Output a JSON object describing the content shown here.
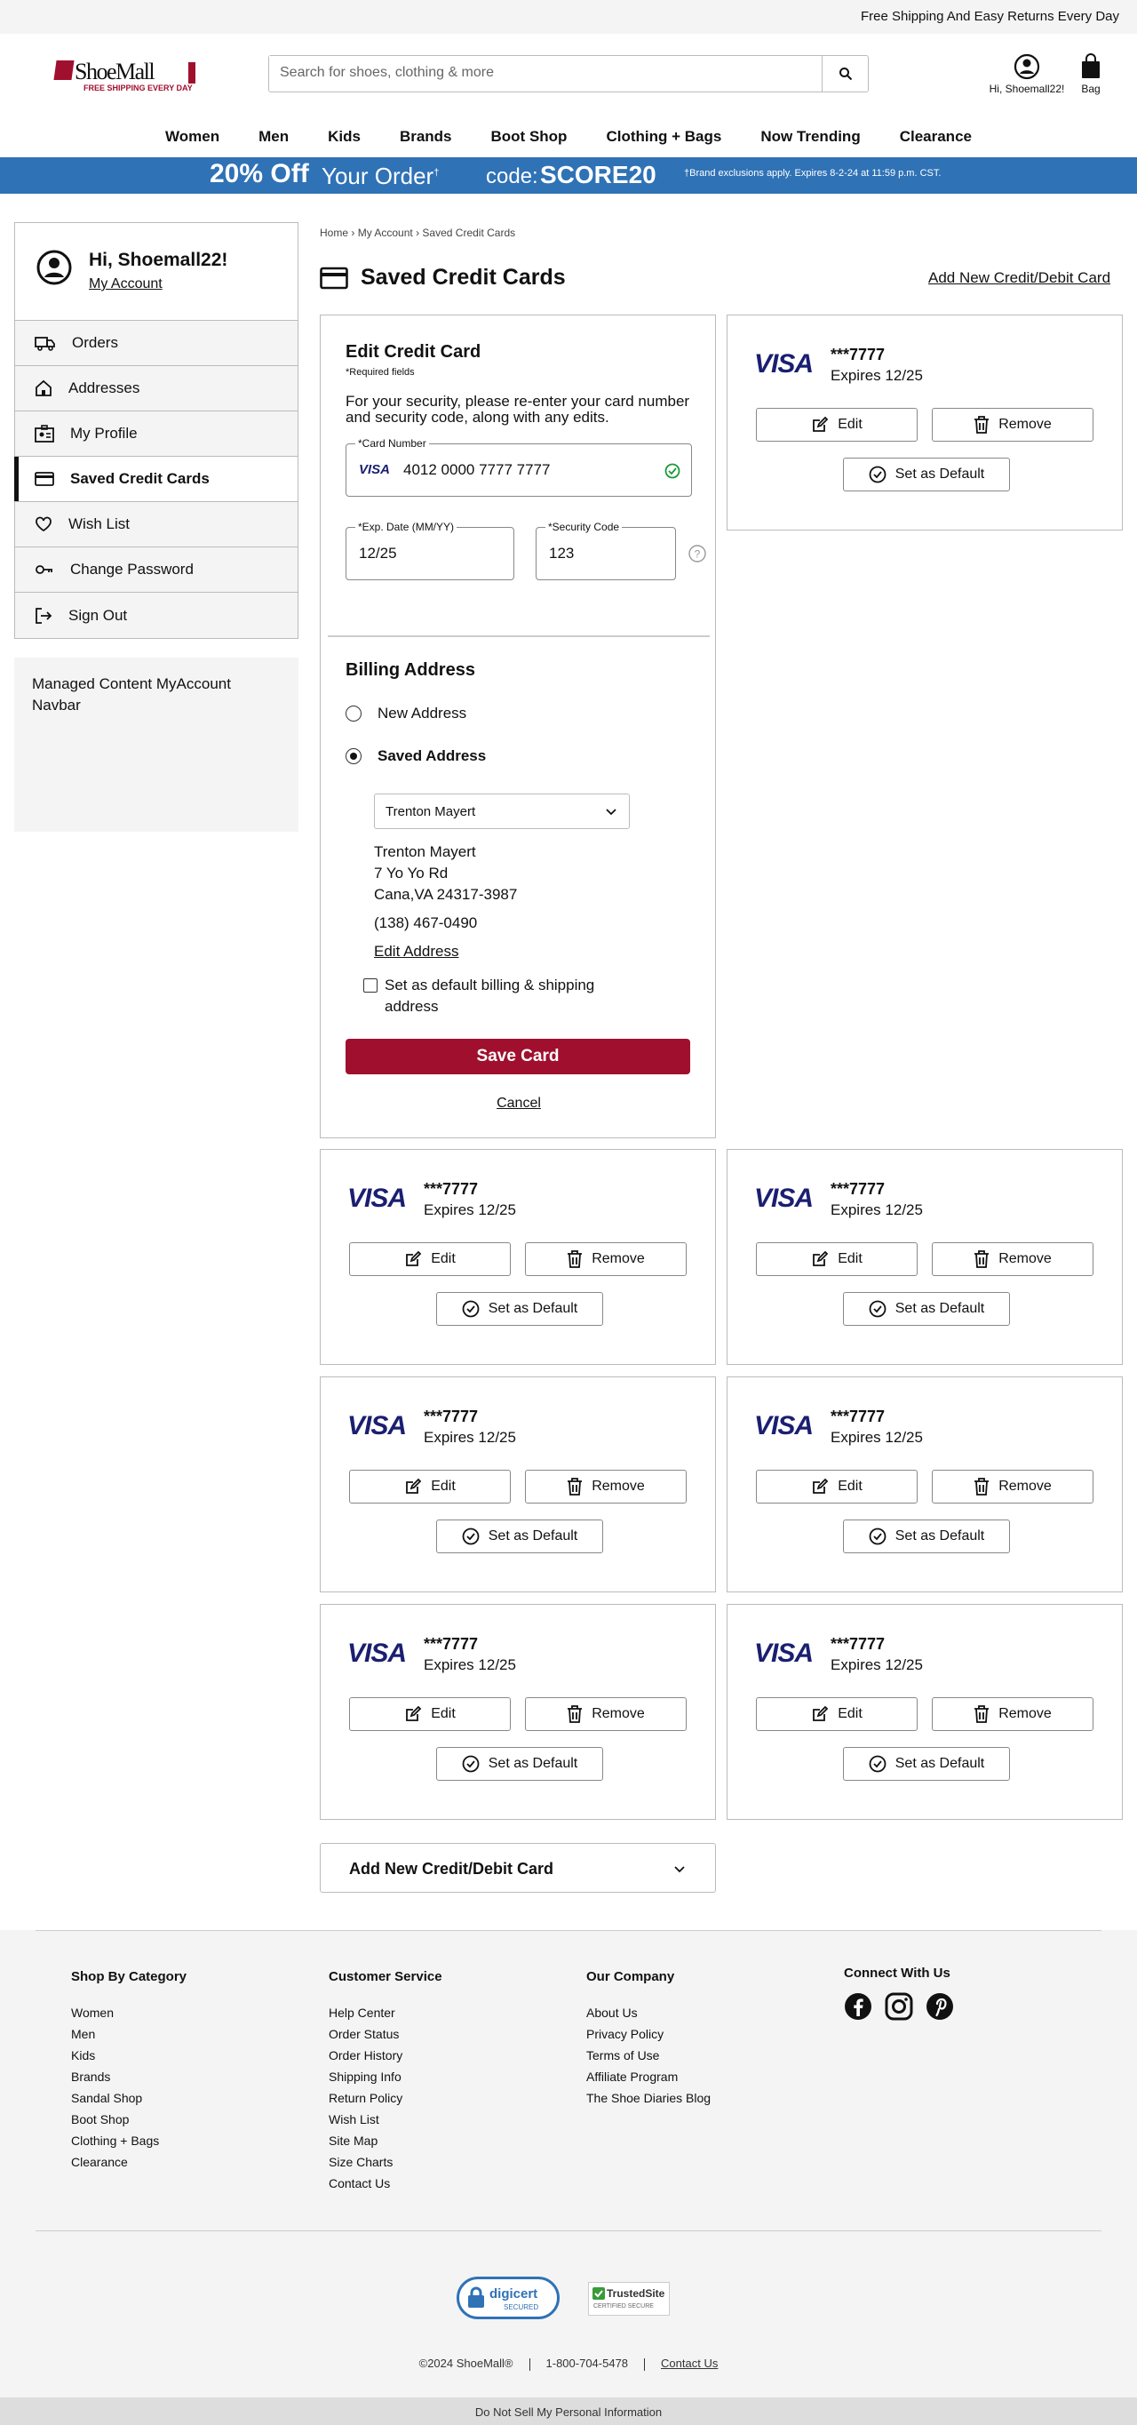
{
  "topbar": {
    "message": "Free Shipping And Easy Returns Every Day"
  },
  "header": {
    "logo_text": "ShoeMall",
    "logo_tagline": "FREE SHIPPING EVERY DAY",
    "search_placeholder": "Search for shoes, clothing & more",
    "account_label": "Hi, Shoemall22!",
    "bag_label": "Bag"
  },
  "nav": [
    "Women",
    "Men",
    "Kids",
    "Brands",
    "Boot Shop",
    "Clothing + Bags",
    "Now Trending",
    "Clearance"
  ],
  "promo": {
    "bold": "20% Off",
    "text": "Your Order",
    "sup": "†",
    "code_label": "code:",
    "code": "SCORE20",
    "fine": "†Brand exclusions apply. Expires 8-2-24 at 11:59 p.m. CST.",
    "bg_color": "#2f72b6"
  },
  "sidebar": {
    "greeting": "Hi, Shoemall22!",
    "account_link": "My Account",
    "items": [
      {
        "label": "Orders",
        "icon": "truck-icon"
      },
      {
        "label": "Addresses",
        "icon": "home-icon"
      },
      {
        "label": "My Profile",
        "icon": "profile-icon"
      },
      {
        "label": "Saved Credit Cards",
        "icon": "credit-card-icon",
        "active": true
      },
      {
        "label": "Wish List",
        "icon": "heart-icon"
      },
      {
        "label": "Change Password",
        "icon": "key-icon"
      },
      {
        "label": "Sign Out",
        "icon": "sign-out-icon"
      }
    ],
    "managed_content": "Managed Content MyAccount Navbar"
  },
  "breadcrumb": {
    "home": "Home",
    "account": "My Account",
    "current": "Saved Credit Cards"
  },
  "page": {
    "title": "Saved Credit Cards",
    "add_link": "Add New Credit/Debit Card"
  },
  "edit_form": {
    "title": "Edit Credit Card",
    "required": "*Required fields",
    "security_note": "For your security, please re-enter your card number and security code, along with any edits.",
    "card_number_label": "*Card Number",
    "card_number": "4012 0000 7777 7777",
    "card_brand": "VISA",
    "exp_label": "*Exp. Date (MM/YY)",
    "exp": "12/25",
    "cvv_label": "*Security Code",
    "cvv": "123",
    "billing_title": "Billing Address",
    "new_address": "New Address",
    "saved_address": "Saved Address",
    "selected_address": "Trenton Mayert",
    "address_lines": [
      "Trenton Mayert",
      "7 Yo Yo Rd",
      "Cana,VA 24317-3987",
      "(138) 467-0490"
    ],
    "edit_address": "Edit Address",
    "default_checkbox": "Set as default billing & shipping address",
    "save": "Save Card",
    "cancel": "Cancel",
    "save_color": "#a0102e"
  },
  "card_common": {
    "brand": "VISA",
    "number": "***7777",
    "expires": "Expires 12/25",
    "edit": "Edit",
    "remove": "Remove",
    "default": "Set as Default"
  },
  "add_new_accordion": "Add New Credit/Debit Card",
  "footer": {
    "shop": {
      "title": "Shop By Category",
      "links": [
        "Women",
        "Men",
        "Kids",
        "Brands",
        "Sandal Shop",
        "Boot Shop",
        "Clothing + Bags",
        "Clearance"
      ]
    },
    "service": {
      "title": "Customer Service",
      "links": [
        "Help Center",
        "Order Status",
        "Order History",
        "Shipping Info",
        "Return Policy",
        "Wish List",
        "Site Map",
        "Size Charts",
        "Contact Us"
      ]
    },
    "company": {
      "title": "Our Company",
      "links": [
        "About Us",
        "Privacy Policy",
        "Terms of Use",
        "Affiliate Program",
        "The Shoe Diaries Blog"
      ]
    },
    "connect": {
      "title": "Connect With Us"
    },
    "digicert": "digicert",
    "digicert_sub": "SECURED",
    "trustedsite": "TrustedSite",
    "trustedsite_sub": "CERTIFIED SECURE",
    "copyright": "©2024 ShoeMall®",
    "phone": "1-800-704-5478",
    "contact": "Contact Us",
    "dns": "Do Not Sell My Personal Information"
  }
}
